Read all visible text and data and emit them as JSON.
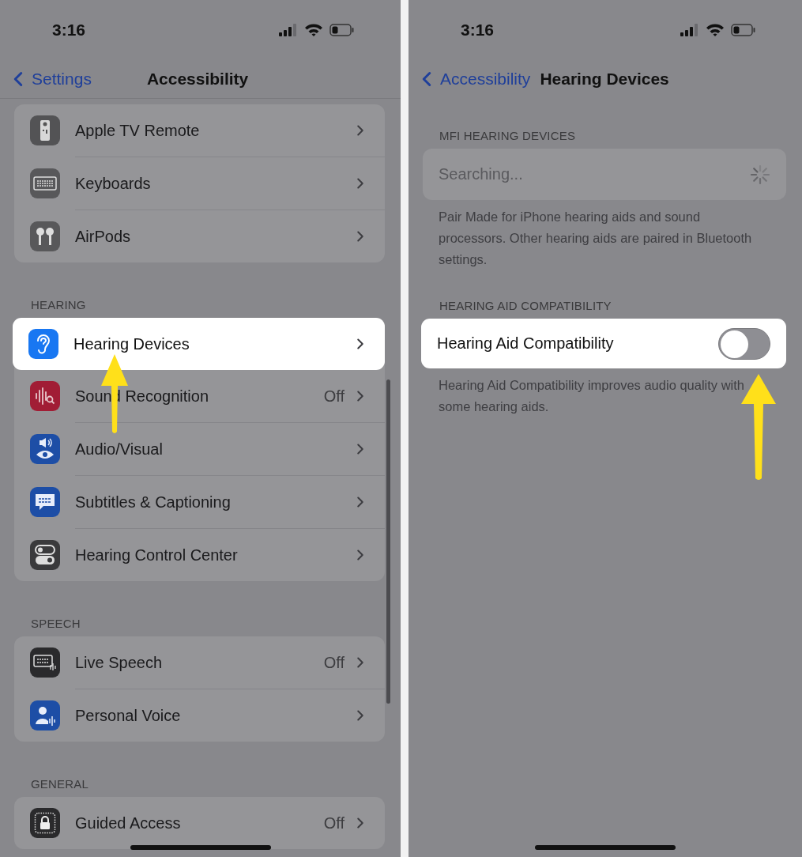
{
  "screens": [
    {
      "status_bar": {
        "time": "3:16"
      },
      "nav": {
        "back": "Settings",
        "title": "Accessibility"
      },
      "scroll_indicator": true,
      "sections": [
        {
          "rows": [
            {
              "kind": "link",
              "label": "Apple TV Remote",
              "color": "#535355",
              "highlighted": false
            },
            {
              "kind": "link",
              "label": "Keyboards",
              "color": "#58585a",
              "highlighted": false
            },
            {
              "kind": "link",
              "label": "AirPods",
              "color": "#58585a",
              "highlighted": false
            }
          ]
        },
        {
          "header": "HEARING",
          "rows": [
            {
              "kind": "link",
              "label": "Hearing Devices",
              "color": "#1877f2",
              "highlighted": true
            },
            {
              "kind": "link",
              "label": "Sound Recognition",
              "value": "Off",
              "color": "#a11d35",
              "highlighted": false
            },
            {
              "kind": "link",
              "label": "Audio/Visual",
              "color": "#1d4ea6",
              "highlighted": false
            },
            {
              "kind": "link",
              "label": "Subtitles & Captioning",
              "color": "#1d4ea6",
              "highlighted": false
            },
            {
              "kind": "link",
              "label": "Hearing Control Center",
              "color": "#3a3a3c",
              "highlighted": false
            }
          ]
        },
        {
          "header": "SPEECH",
          "rows": [
            {
              "kind": "link",
              "label": "Live Speech",
              "value": "Off",
              "color": "#2a2a2c",
              "highlighted": false
            },
            {
              "kind": "link",
              "label": "Personal Voice",
              "color": "#1d4ea6",
              "highlighted": false
            }
          ]
        },
        {
          "header": "GENERAL",
          "rows": [
            {
              "kind": "link",
              "label": "Guided Access",
              "value": "Off",
              "color": "#2a2a2c",
              "highlighted": false
            }
          ]
        }
      ]
    },
    {
      "status_bar": {
        "time": "3:16"
      },
      "nav": {
        "back": "Accessibility",
        "title": "Hearing Devices"
      },
      "sections": [
        {
          "header": "MFI HEARING DEVICES",
          "rows": [
            {
              "kind": "searching",
              "label": "Searching...",
              "highlighted": false
            }
          ],
          "footer": "Pair Made for iPhone hearing aids and sound processors. Other hearing aids are paired in Bluetooth settings."
        },
        {
          "header": "HEARING AID COMPATIBILITY",
          "rows": [
            {
              "kind": "toggle",
              "label": "Hearing Aid Compatibility",
              "on": false,
              "highlighted": true
            }
          ],
          "footer": "Hearing Aid Compatibility improves audio quality with some hearing aids."
        }
      ]
    }
  ]
}
